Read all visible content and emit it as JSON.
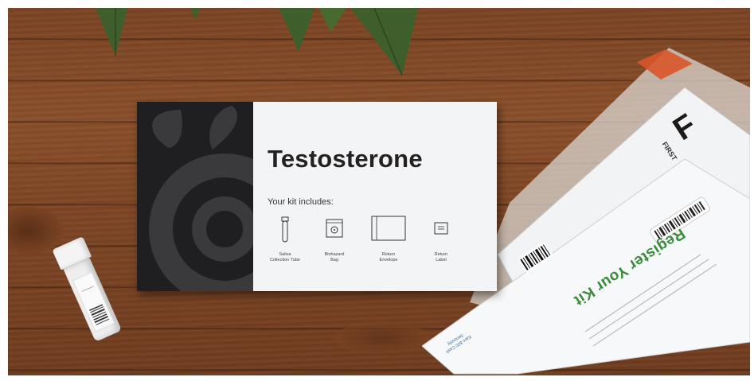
{
  "kit_card": {
    "title": "Testosterone",
    "subtitle": "Your kit includes:",
    "items": [
      {
        "icon": "test-tube-icon",
        "label_line1": "Saliva",
        "label_line2": "Collection Tube"
      },
      {
        "icon": "biohazard-bag-icon",
        "label_line1": "Biohazard",
        "label_line2": "Bag"
      },
      {
        "icon": "envelope-icon",
        "label_line1": "Return",
        "label_line2": "Envelope"
      },
      {
        "icon": "label-icon",
        "label_line1": "Return",
        "label_line2": "Label"
      }
    ]
  },
  "envelope": {
    "heading": "Register Your Kit",
    "stamp_letter": "F",
    "stamp_text": "FIRST",
    "corner_note_line1": "Earn $20 Cash",
    "corner_note_line2": "Seriously"
  },
  "colors": {
    "card_dark": "#1f1f22",
    "card_light": "#f3f4f6",
    "wood": "#7d4625",
    "register_green": "#3a8b3a"
  }
}
